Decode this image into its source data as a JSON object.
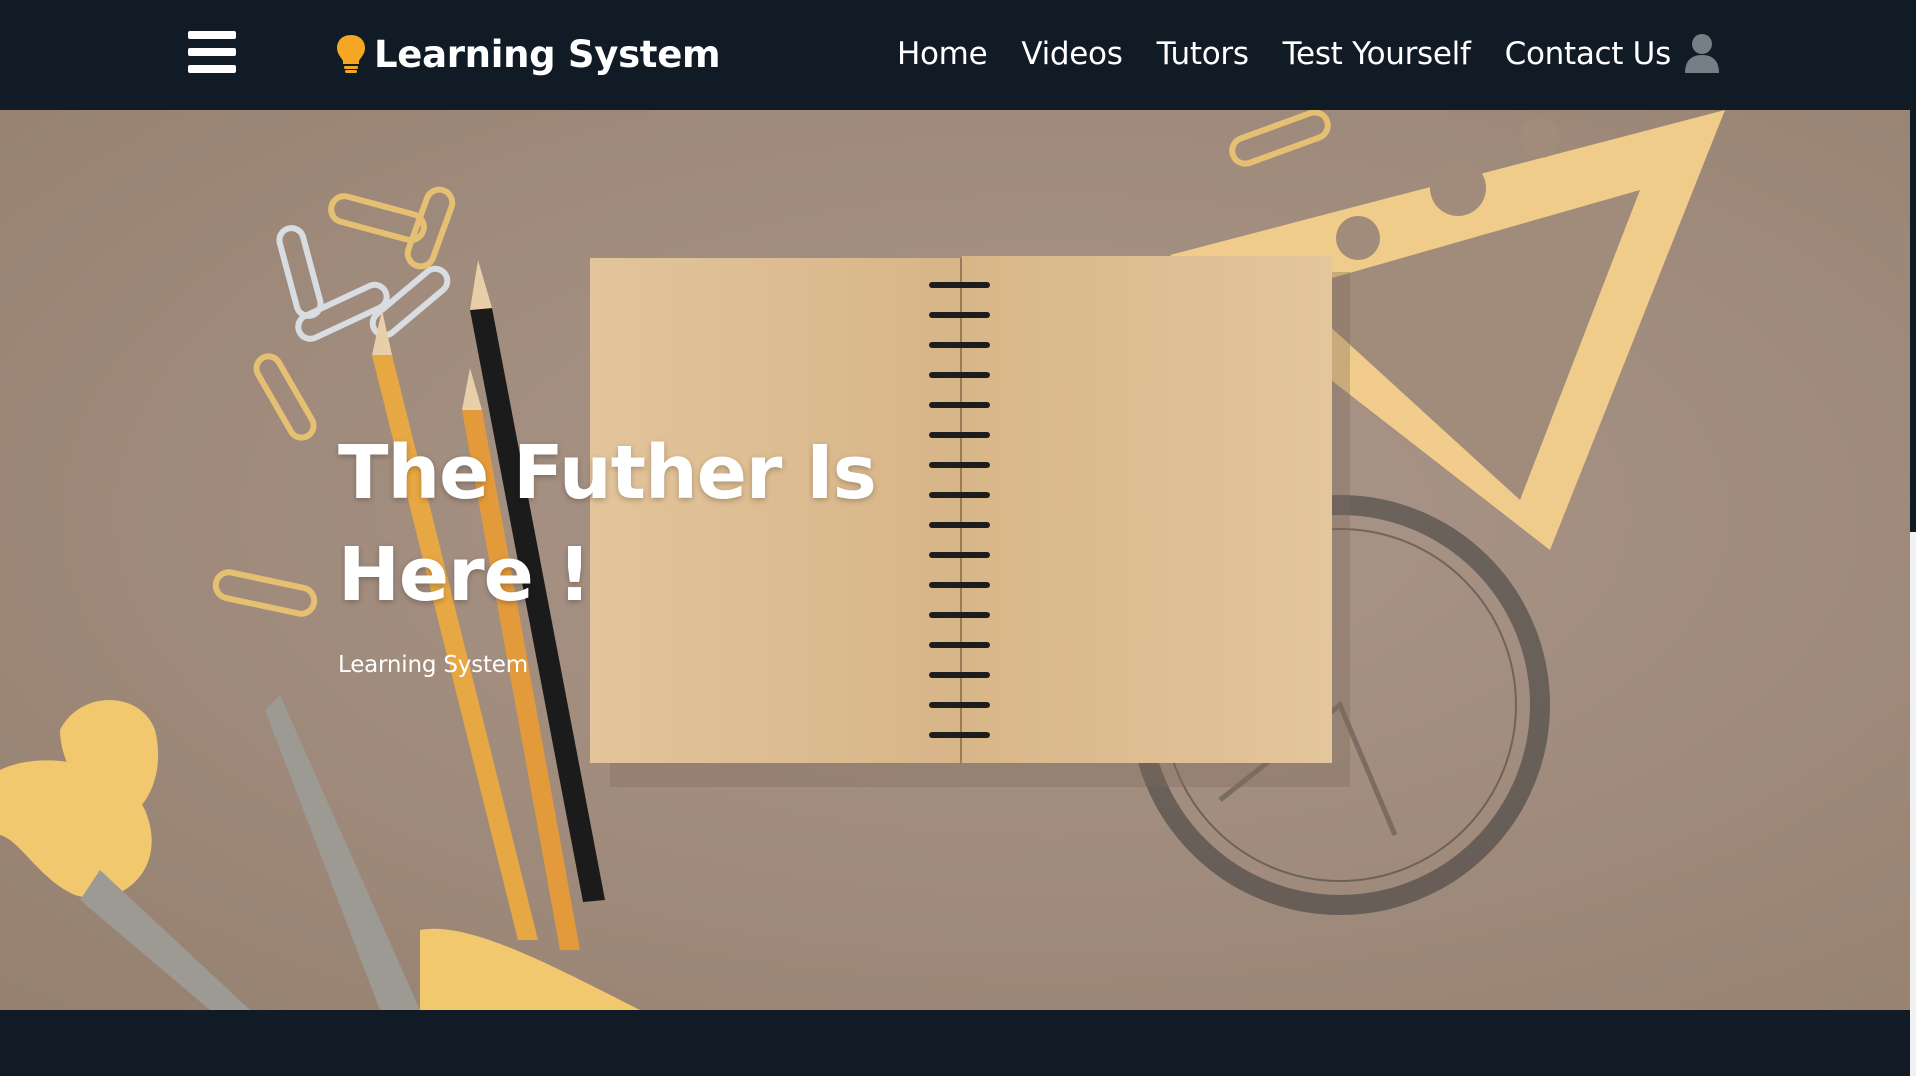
{
  "brand": {
    "name": "Learning System",
    "icon": "lightbulb-icon",
    "icon_color": "#f5a623"
  },
  "nav": {
    "menu_icon": "hamburger-menu-icon",
    "items": [
      {
        "label": "Home"
      },
      {
        "label": "Videos"
      },
      {
        "label": "Tutors"
      },
      {
        "label": "Test Yourself"
      },
      {
        "label": "Contact Us"
      }
    ],
    "user_icon": "user-avatar-icon"
  },
  "hero": {
    "title_line1": "The Futher Is",
    "title_line2": "Here !",
    "subtitle": "Learning System",
    "background": "desk-stationery-photo"
  },
  "colors": {
    "navbar_bg": "#111b26",
    "hero_bg": "#a18d7e",
    "accent": "#f5a623",
    "text": "#ffffff"
  }
}
